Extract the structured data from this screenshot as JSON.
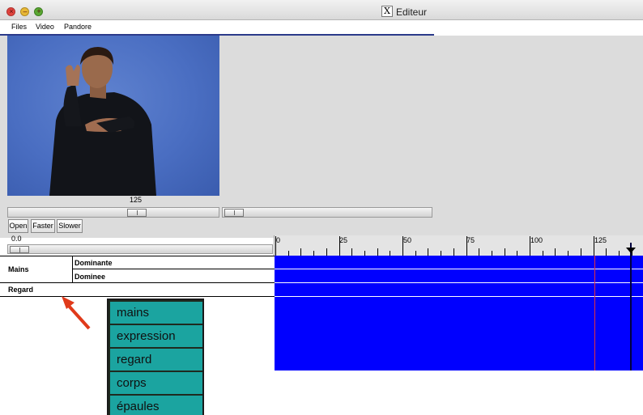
{
  "window": {
    "title": "Editeur",
    "title_icon": "X"
  },
  "menu": [
    "Files",
    "Video",
    "Pandore"
  ],
  "player": {
    "frame_label": "125",
    "buttons": {
      "open": "Open",
      "faster": "Faster",
      "slower": "Slower"
    },
    "speed_label": "0.0"
  },
  "ruler": {
    "labels": [
      "0",
      "25",
      "50",
      "75",
      "100",
      "125"
    ]
  },
  "tracks": {
    "group_label": "Mains",
    "dominante": "Dominante",
    "dominee": "Dominee",
    "regard": "Regard"
  },
  "legend": [
    "mains",
    "expression",
    "regard",
    "corps",
    "épaules"
  ],
  "colors": {
    "track": "#0000ff",
    "legend": "#1ba4a0",
    "arrow": "#e03a1a",
    "marker": "#e03040"
  }
}
